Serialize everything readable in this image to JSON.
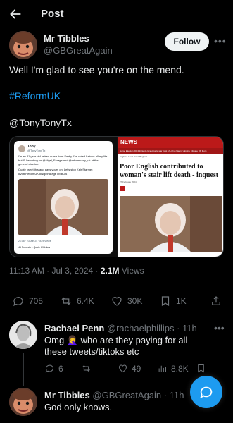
{
  "header": {
    "title": "Post"
  },
  "post": {
    "author_name": "Mr Tibbles",
    "author_handle": "@GBGreatAgain",
    "follow_label": "Follow",
    "text_line1": "Well I'm glad to see you're on the mend.",
    "hashtag": "#ReformUK",
    "mention": "@TonyTonyTx",
    "time": "11:13 AM · Jul 3, 2024 ·",
    "views_count": "2.1M",
    "views_label": "Views",
    "replies": "705",
    "reposts": "6.4K",
    "likes": "30K",
    "bookmarks": "1K"
  },
  "media": {
    "left_card": {
      "name": "Tony",
      "handle": "@TonyTonyTx",
      "text": "I'm an 81 year old retired nurse from Derby. I've voted Labour all my life but I'll be voting for @Nigel_Farage and @reformparty_uk at the general election.",
      "text2": "Quote tweet this and pass yours on. Let's stop Keir Starmer. #VoteReformUK #NigelFarage #MBGA",
      "time": "21:18 · 23 Jun 24 · 839 Views",
      "stats": "46 Reposts   1 Quote   89 Likes"
    },
    "right_card": {
      "brand": "NEWS",
      "nav": "Home   Election 2024   InDepth   Israel-Gaza war   Cost of Living   War in Ukraine   Climate   UK   More",
      "subnav": "England   Local News   Regions",
      "headline": "Poor English contributed to woman's stair lift death - inquest",
      "date": "27 February 2024"
    }
  },
  "reply1": {
    "name": "Rachael Penn",
    "handle": "@rachaelphillips · 11h",
    "text": "Omg 🤦‍♀️ who are they paying for all these tweets/tiktoks etc",
    "replies": "6",
    "likes": "49",
    "views": "8.8K"
  },
  "reply2": {
    "name": "Mr Tibbles",
    "handle": "@GBGreatAgain · 11h",
    "text": "God only knows."
  },
  "colors": {
    "accent": "#1d9bf0",
    "background": "#000000",
    "muted": "#71767b",
    "bbc_red": "#bb1919"
  }
}
